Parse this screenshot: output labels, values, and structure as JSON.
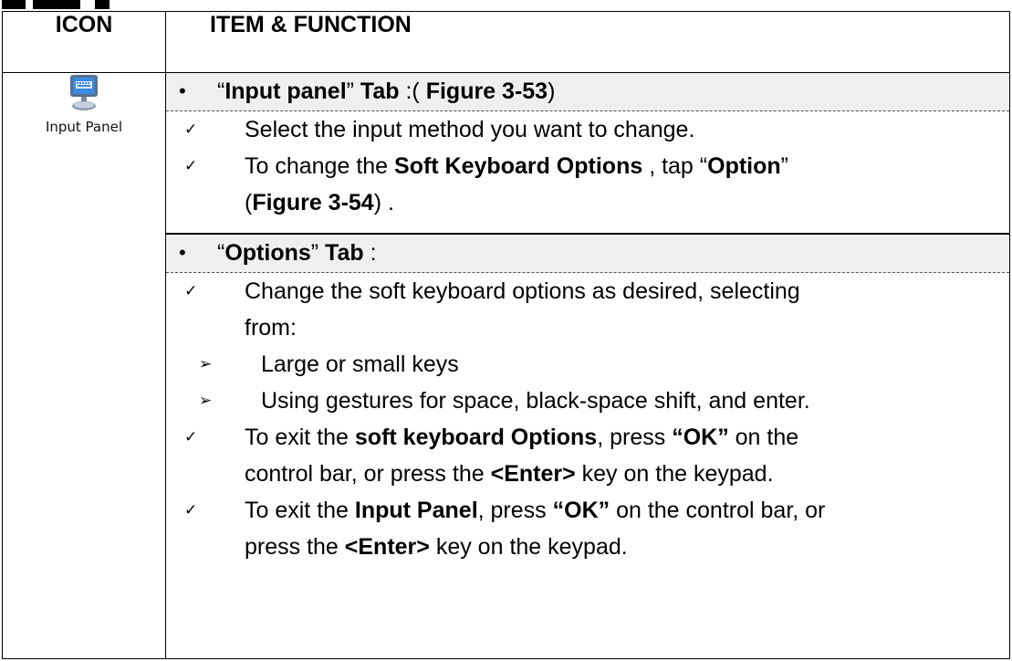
{
  "header": {
    "icon_col": "ICON",
    "item_col": "ITEM & FUNCTION"
  },
  "icon": {
    "name": "monitor-keyboard-icon",
    "caption": "Input Panel"
  },
  "section1": {
    "bullet": "•",
    "quote_open": "“",
    "name": "Input panel",
    "quote_close": "”",
    "tab": " Tab",
    "mid": " :( ",
    "figure": "Figure 3-53",
    "end": ")",
    "items": [
      {
        "mark": "✓",
        "text": "Select the input method you want to change."
      },
      {
        "mark": "✓",
        "pre": "To change the ",
        "bold": "Soft Keyboard Options",
        "post": " , tap “",
        "bold2": "Option",
        "post2": "”",
        "line2_open": "(",
        "line2_bold": "Figure 3-54",
        "line2_close": ") ."
      }
    ]
  },
  "section2": {
    "bullet": "•",
    "quote_open": "“",
    "name": "Options",
    "quote_close": "”",
    "tab": " Tab",
    "end": " :",
    "items": [
      {
        "mark": "✓",
        "line1": "Change the soft keyboard options as desired, selecting",
        "line2": "from:"
      },
      {
        "mark": "➢",
        "text": "Large or small keys"
      },
      {
        "mark": "➢",
        "text": "Using gestures for space, black-space shift, and enter."
      },
      {
        "mark": "✓",
        "pre": "To exit the ",
        "bold": "soft keyboard Options",
        "mid": ", press ",
        "bold2": "“OK”",
        "post": " on the",
        "l2_pre": "control bar, or press the ",
        "l2_bold": "<Enter>",
        "l2_post": " key on the keypad."
      },
      {
        "mark": "✓",
        "pre": "To exit the ",
        "bold": "Input Panel",
        "mid": ", press ",
        "bold2": "“OK”",
        "post": " on the control bar, or",
        "l2_pre": "press the ",
        "l2_bold": "<Enter>",
        "l2_post": " key on the keypad."
      }
    ]
  }
}
